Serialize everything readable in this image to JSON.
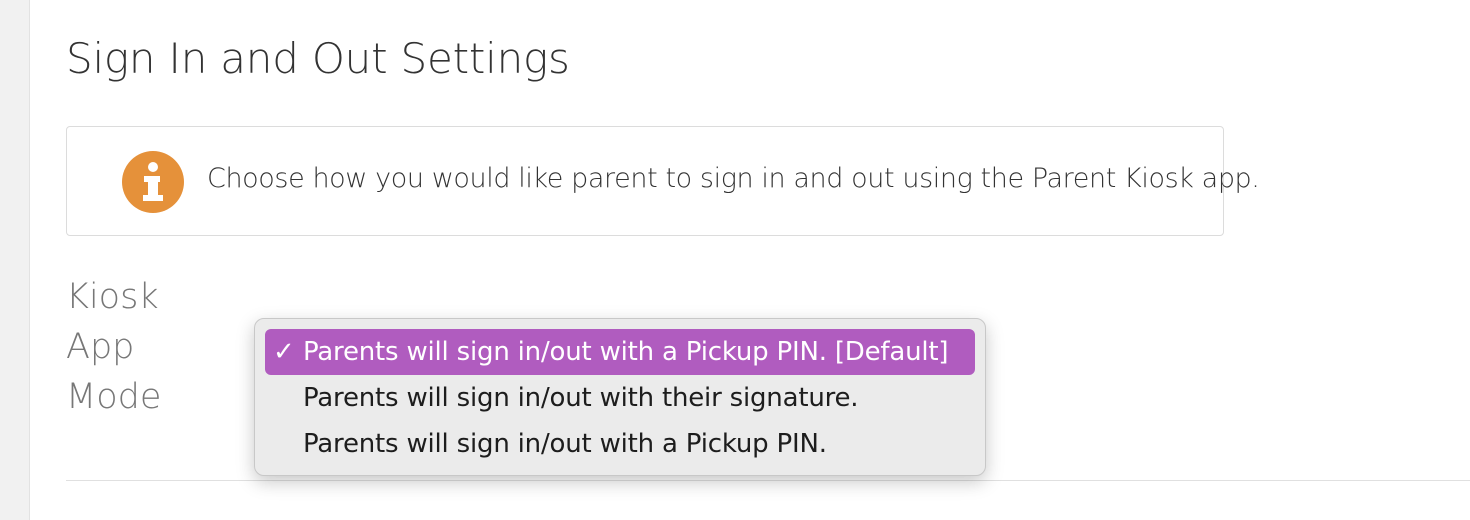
{
  "page": {
    "title": "Sign In and Out Settings"
  },
  "info": {
    "icon": "info-icon",
    "text": "Choose how you would like parent to sign in and out using the Parent Kiosk app."
  },
  "kiosk_mode": {
    "label": "Kiosk App Mode",
    "options": [
      {
        "label": "Parents will sign in/out with a Pickup PIN. [Default]",
        "selected": true
      },
      {
        "label": "Parents will sign in/out with their signature.",
        "selected": false
      },
      {
        "label": "Parents will sign in/out with a Pickup PIN.",
        "selected": false
      }
    ],
    "check_glyph": "✓"
  },
  "colors": {
    "accent": "#b05cbf",
    "info_icon": "#e5913a"
  }
}
